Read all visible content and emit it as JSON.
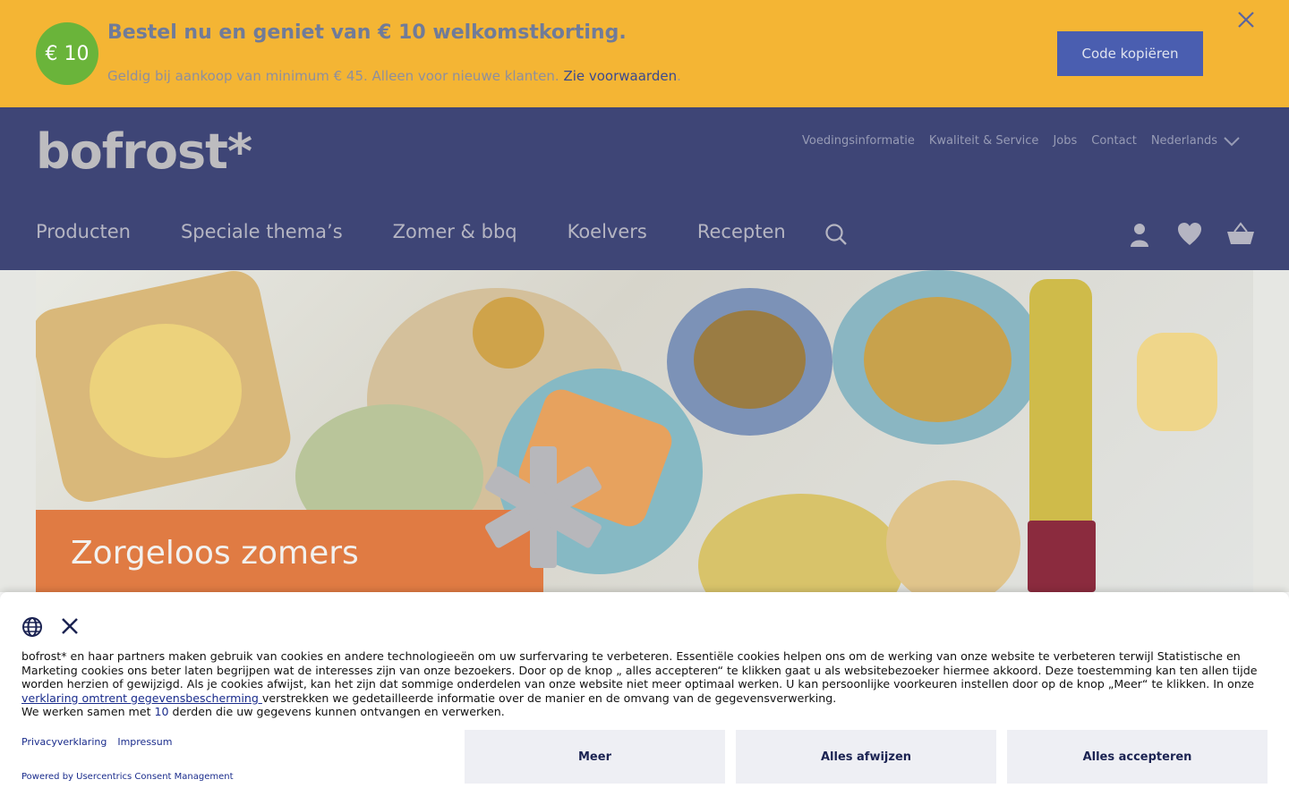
{
  "promo": {
    "badge": "€ 10",
    "title": "Bestel nu en geniet van € 10 welkomstkorting.",
    "subtitle": "Geldig bij aankoop van minimum € 45. Alleen voor nieuwe klanten.",
    "terms_link": "Zie voorwaarden",
    "terms_suffix": ".",
    "copy_button": "Code kopiëren",
    "close_icon": "close-icon"
  },
  "header": {
    "logo": "bofrost*",
    "utility_links": [
      "Voedingsinformatie",
      "Kwaliteit & Service",
      "Jobs",
      "Contact"
    ],
    "language": "Nederlands",
    "nav": [
      "Producten",
      "Speciale thema’s",
      "Zomer & bbq",
      "Koelvers",
      "Recepten"
    ],
    "icons": [
      "search-icon",
      "account-icon",
      "heart-icon",
      "basket-icon"
    ]
  },
  "hero": {
    "title": "Zorgeloos zomers"
  },
  "consent": {
    "text_part1": "bofrost* en haar partners maken gebruik van cookies en andere technologieeën om uw surfervaring te verbeteren. Essentiële cookies helpen ons om de werking van onze website te verbeteren terwijl Statistische en Marketing cookies ons beter laten begrijpen wat de interesses zijn van onze bezoekers. Door op de knop „ alles accepteren“ te klikken gaat u als websitebezoeker hiermee akkoord. Deze toestemming kan ten allen tijde worden herzien of gewijzigd. Als je cookies afwijst, kan het zijn dat sommige onderdelen van onze website niet meer optimaal werken. U kan persoonlijke voorkeuren instellen door op de knop „Meer“ te klikken. In onze ",
    "privacy_link": "verklaring omtrent gegevensbescherming ",
    "text_part2": "verstrekken we gedetailleerde informatie over de manier en de omvang van de gegevensverwerking.",
    "partners_prefix": "We werken samen met ",
    "partners_count": "10",
    "partners_suffix": " derden die uw gegevens kunnen ontvangen en verwerken.",
    "links": [
      "Privacyverklaring",
      "Impressum"
    ],
    "powered_by": "Powered by Usercentrics Consent Management",
    "buttons": {
      "more": "Meer",
      "reject": "Alles afwijzen",
      "accept": "Alles accepteren"
    }
  }
}
